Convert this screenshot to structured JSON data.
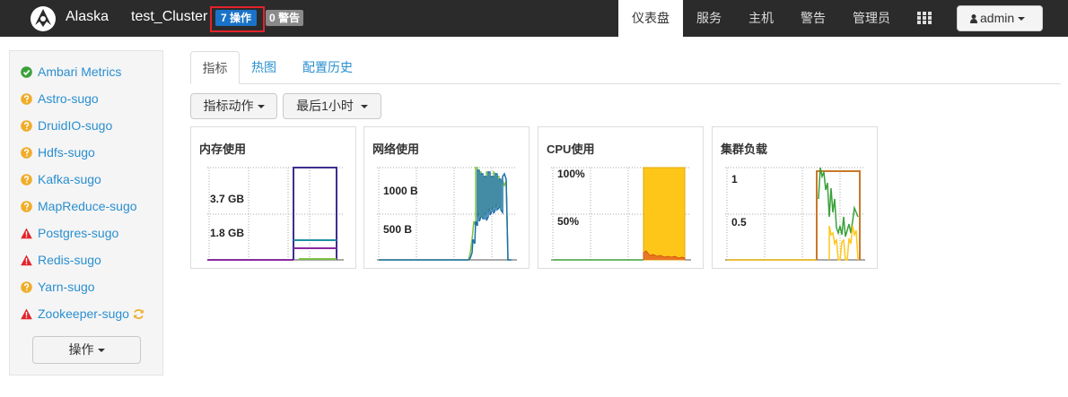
{
  "nav": {
    "brand": "Alaska",
    "cluster_name": "test_Cluster",
    "ops_badge": "7 操作",
    "alerts_badge": "0 警告",
    "items": [
      {
        "label": "仪表盘",
        "active": true
      },
      {
        "label": "服务",
        "active": false
      },
      {
        "label": "主机",
        "active": false
      },
      {
        "label": "警告",
        "active": false
      },
      {
        "label": "管理员",
        "active": false
      }
    ],
    "user_label": "admin",
    "icons": [
      "alaska-logo-icon",
      "grid-menu-icon",
      "user-icon",
      "caret-down-icon"
    ]
  },
  "sidebar": {
    "services": [
      {
        "name": "Ambari Metrics",
        "status": "ok"
      },
      {
        "name": "Astro-sugo",
        "status": "unknown"
      },
      {
        "name": "DruidIO-sugo",
        "status": "unknown"
      },
      {
        "name": "Hdfs-sugo",
        "status": "unknown"
      },
      {
        "name": "Kafka-sugo",
        "status": "unknown"
      },
      {
        "name": "MapReduce-sugo",
        "status": "unknown"
      },
      {
        "name": "Postgres-sugo",
        "status": "critical"
      },
      {
        "name": "Redis-sugo",
        "status": "critical"
      },
      {
        "name": "Yarn-sugo",
        "status": "unknown"
      },
      {
        "name": "Zookeeper-sugo",
        "status": "critical",
        "refreshing": true
      }
    ],
    "actions_label": "操作",
    "status_colors": {
      "ok": "#3aa13a",
      "unknown": "#f0ad2b",
      "critical": "#e3232b"
    }
  },
  "tabs": [
    {
      "label": "指标",
      "active": true
    },
    {
      "label": "热图",
      "active": false
    },
    {
      "label": "配置历史",
      "active": false
    }
  ],
  "toolbar": {
    "metric_actions_label": "指标动作",
    "time_range_label": "最后1小时"
  },
  "widgets": [
    {
      "title": "内存使用",
      "y_labels": [
        "3.7 GB",
        "1.8 GB"
      ]
    },
    {
      "title": "网络使用",
      "y_labels": [
        "1000 B",
        "500 B"
      ]
    },
    {
      "title": "CPU使用",
      "y_labels": [
        "100%",
        "50%"
      ]
    },
    {
      "title": "集群负载",
      "y_labels": [
        "1",
        "0.5"
      ]
    }
  ]
}
